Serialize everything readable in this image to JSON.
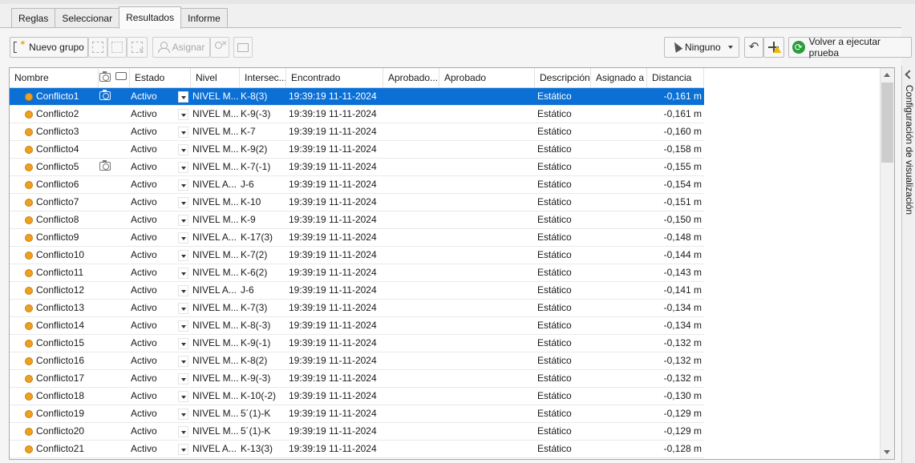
{
  "tabs": [
    {
      "label": "Reglas",
      "active": false
    },
    {
      "label": "Seleccionar",
      "active": false
    },
    {
      "label": "Resultados",
      "active": true
    },
    {
      "label": "Informe",
      "active": false
    }
  ],
  "toolbar": {
    "new_group": "Nuevo grupo",
    "assign": "Asignar",
    "filter_value": "Ninguno",
    "rerun": "Volver a ejecutar prueba"
  },
  "columns": {
    "name": "Nombre",
    "status": "Estado",
    "level": "Nivel",
    "intersection": "Intersec...",
    "found": "Encontrado",
    "approved_by": "Aprobado...",
    "approved": "Aprobado",
    "description": "Descripción",
    "assigned_to": "Asignado a",
    "distance": "Distancia"
  },
  "rows": [
    {
      "name": "Conflicto1",
      "photo": true,
      "status": "Activo",
      "level": "NIVEL M...",
      "grid": "K-8(3)",
      "found": "19:39:19 11-11-2024",
      "desc": "Estático",
      "dist": "-0,161 m",
      "selected": true
    },
    {
      "name": "Conflicto2",
      "photo": false,
      "status": "Activo",
      "level": "NIVEL M...",
      "grid": "K-9(-3)",
      "found": "19:39:19 11-11-2024",
      "desc": "Estático",
      "dist": "-0,161 m"
    },
    {
      "name": "Conflicto3",
      "photo": false,
      "status": "Activo",
      "level": "NIVEL M...",
      "grid": "K-7",
      "found": "19:39:19 11-11-2024",
      "desc": "Estático",
      "dist": "-0,160 m"
    },
    {
      "name": "Conflicto4",
      "photo": false,
      "status": "Activo",
      "level": "NIVEL M...",
      "grid": "K-9(2)",
      "found": "19:39:19 11-11-2024",
      "desc": "Estático",
      "dist": "-0,158 m"
    },
    {
      "name": "Conflicto5",
      "photo": true,
      "status": "Activo",
      "level": "NIVEL M...",
      "grid": "K-7(-1)",
      "found": "19:39:19 11-11-2024",
      "desc": "Estático",
      "dist": "-0,155 m"
    },
    {
      "name": "Conflicto6",
      "photo": false,
      "status": "Activo",
      "level": "NIVEL A...",
      "grid": "J-6",
      "found": "19:39:19 11-11-2024",
      "desc": "Estático",
      "dist": "-0,154 m"
    },
    {
      "name": "Conflicto7",
      "photo": false,
      "status": "Activo",
      "level": "NIVEL M...",
      "grid": "K-10",
      "found": "19:39:19 11-11-2024",
      "desc": "Estático",
      "dist": "-0,151 m"
    },
    {
      "name": "Conflicto8",
      "photo": false,
      "status": "Activo",
      "level": "NIVEL M...",
      "grid": "K-9",
      "found": "19:39:19 11-11-2024",
      "desc": "Estático",
      "dist": "-0,150 m"
    },
    {
      "name": "Conflicto9",
      "photo": false,
      "status": "Activo",
      "level": "NIVEL A...",
      "grid": "K-17(3)",
      "found": "19:39:19 11-11-2024",
      "desc": "Estático",
      "dist": "-0,148 m"
    },
    {
      "name": "Conflicto10",
      "photo": false,
      "status": "Activo",
      "level": "NIVEL M...",
      "grid": "K-7(2)",
      "found": "19:39:19 11-11-2024",
      "desc": "Estático",
      "dist": "-0,144 m"
    },
    {
      "name": "Conflicto11",
      "photo": false,
      "status": "Activo",
      "level": "NIVEL M...",
      "grid": "K-6(2)",
      "found": "19:39:19 11-11-2024",
      "desc": "Estático",
      "dist": "-0,143 m"
    },
    {
      "name": "Conflicto12",
      "photo": false,
      "status": "Activo",
      "level": "NIVEL A...",
      "grid": "J-6",
      "found": "19:39:19 11-11-2024",
      "desc": "Estático",
      "dist": "-0,141 m"
    },
    {
      "name": "Conflicto13",
      "photo": false,
      "status": "Activo",
      "level": "NIVEL M...",
      "grid": "K-7(3)",
      "found": "19:39:19 11-11-2024",
      "desc": "Estático",
      "dist": "-0,134 m"
    },
    {
      "name": "Conflicto14",
      "photo": false,
      "status": "Activo",
      "level": "NIVEL M...",
      "grid": "K-8(-3)",
      "found": "19:39:19 11-11-2024",
      "desc": "Estático",
      "dist": "-0,134 m"
    },
    {
      "name": "Conflicto15",
      "photo": false,
      "status": "Activo",
      "level": "NIVEL M...",
      "grid": "K-9(-1)",
      "found": "19:39:19 11-11-2024",
      "desc": "Estático",
      "dist": "-0,132 m"
    },
    {
      "name": "Conflicto16",
      "photo": false,
      "status": "Activo",
      "level": "NIVEL M...",
      "grid": "K-8(2)",
      "found": "19:39:19 11-11-2024",
      "desc": "Estático",
      "dist": "-0,132 m"
    },
    {
      "name": "Conflicto17",
      "photo": false,
      "status": "Activo",
      "level": "NIVEL M...",
      "grid": "K-9(-3)",
      "found": "19:39:19 11-11-2024",
      "desc": "Estático",
      "dist": "-0,132 m"
    },
    {
      "name": "Conflicto18",
      "photo": false,
      "status": "Activo",
      "level": "NIVEL M...",
      "grid": "K-10(-2)",
      "found": "19:39:19 11-11-2024",
      "desc": "Estático",
      "dist": "-0,130 m"
    },
    {
      "name": "Conflicto19",
      "photo": false,
      "status": "Activo",
      "level": "NIVEL M...",
      "grid": "5´(1)-K",
      "found": "19:39:19 11-11-2024",
      "desc": "Estático",
      "dist": "-0,129 m"
    },
    {
      "name": "Conflicto20",
      "photo": false,
      "status": "Activo",
      "level": "NIVEL M...",
      "grid": "5´(1)-K",
      "found": "19:39:19 11-11-2024",
      "desc": "Estático",
      "dist": "-0,129 m"
    },
    {
      "name": "Conflicto21",
      "photo": false,
      "status": "Activo",
      "level": "NIVEL A...",
      "grid": "K-13(3)",
      "found": "19:39:19 11-11-2024",
      "desc": "Estático",
      "dist": "-0,128 m"
    }
  ],
  "side_panel": {
    "label": "Configuración de visualización"
  },
  "colors": {
    "selected_row": "#0a70d6",
    "status_dot": "#f0a020",
    "rerun_icon": "#2a9d3a"
  }
}
